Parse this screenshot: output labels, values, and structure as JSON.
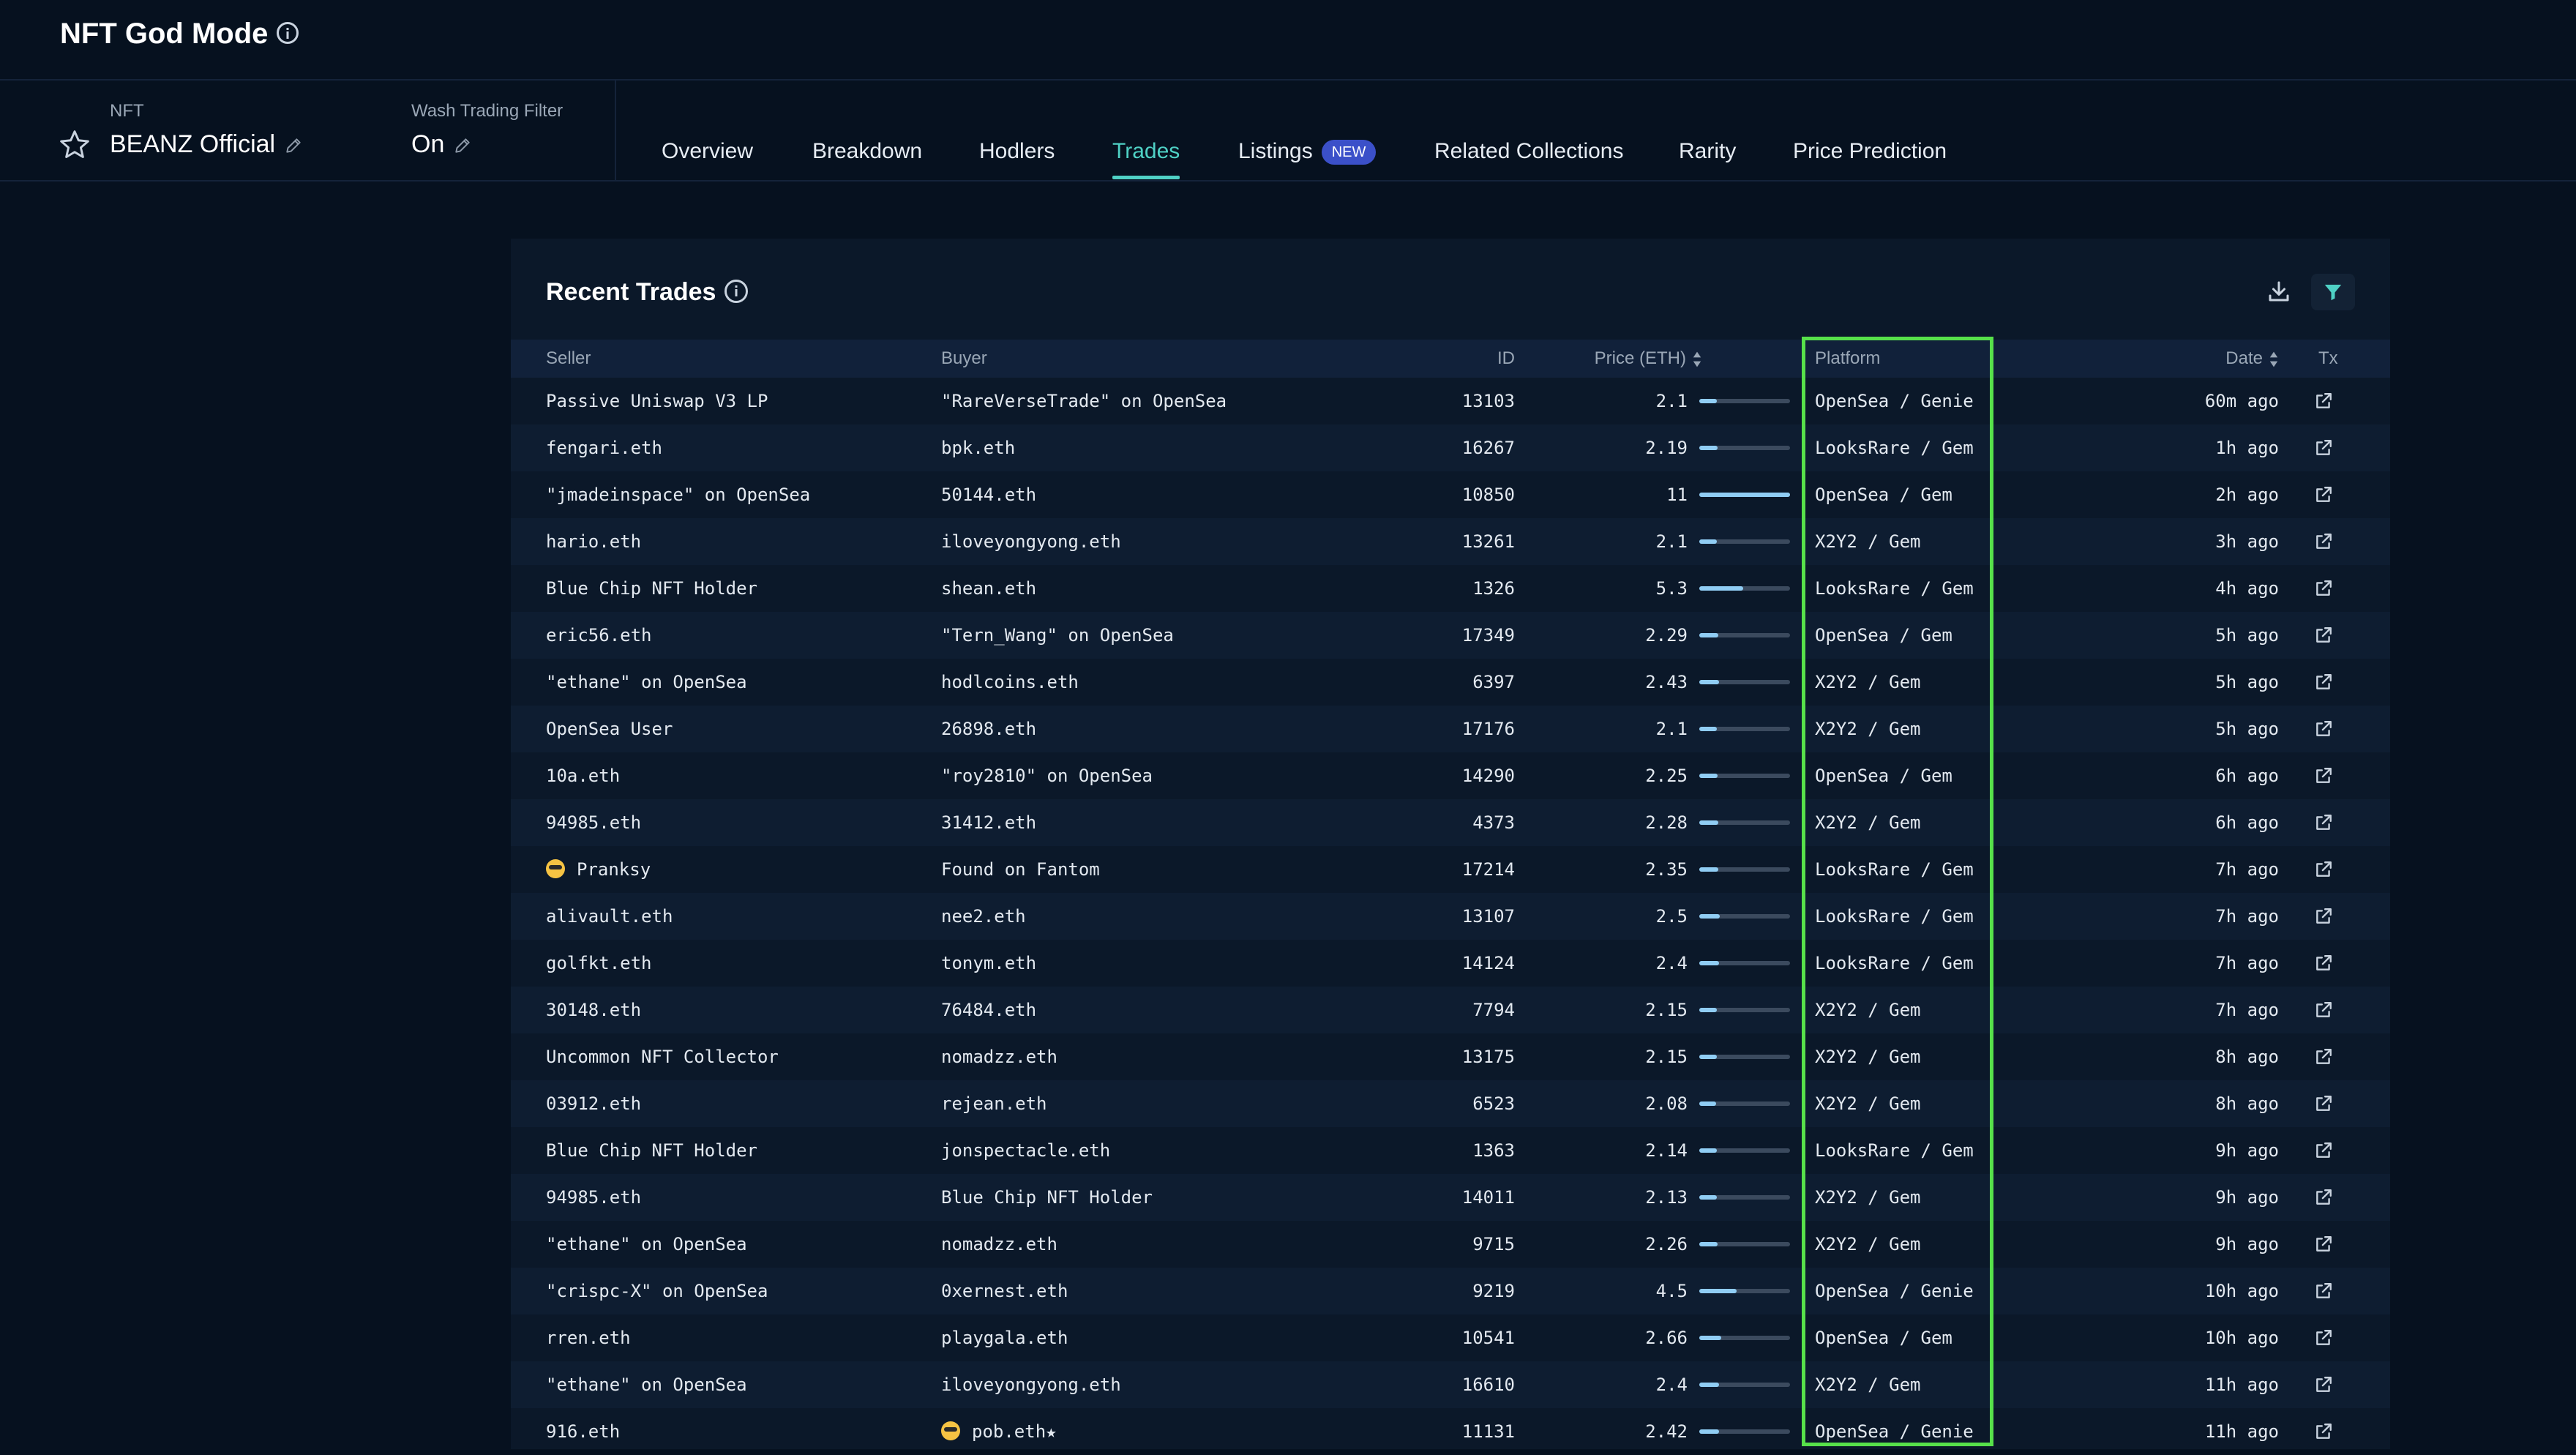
{
  "app": {
    "title": "NFT God Mode"
  },
  "nft": {
    "label": "NFT",
    "name": "BEANZ Official"
  },
  "wash_filter": {
    "label": "Wash Trading Filter",
    "value": "On"
  },
  "tabs": [
    {
      "label": "Overview"
    },
    {
      "label": "Breakdown"
    },
    {
      "label": "Hodlers"
    },
    {
      "label": "Trades",
      "active": true
    },
    {
      "label": "Listings",
      "badge": "NEW"
    },
    {
      "label": "Related Collections"
    },
    {
      "label": "Rarity"
    },
    {
      "label": "Price Prediction"
    }
  ],
  "panel": {
    "title": "Recent Trades"
  },
  "columns": {
    "seller": "Seller",
    "buyer": "Buyer",
    "id": "ID",
    "price": "Price (ETH)",
    "platform": "Platform",
    "date": "Date",
    "tx": "Tx"
  },
  "colors": {
    "accent": "#4fd1c5",
    "highlight": "#57e14a",
    "badge": "#3b50c9",
    "bar": "#90cdf4"
  },
  "price_bar_max": 11,
  "rows": [
    {
      "seller": "Passive Uniswap V3 LP",
      "buyer": "\"RareVerseTrade\" on OpenSea",
      "id": "13103",
      "price": "2.1",
      "platform": "OpenSea / Genie",
      "date": "60m ago"
    },
    {
      "seller": "fengari.eth",
      "buyer": "bpk.eth",
      "id": "16267",
      "price": "2.19",
      "platform": "LooksRare / Gem",
      "date": "1h ago"
    },
    {
      "seller": "\"jmadeinspace\" on OpenSea",
      "buyer": "50144.eth",
      "id": "10850",
      "price": "11",
      "platform": "OpenSea / Gem",
      "date": "2h ago"
    },
    {
      "seller": "hario.eth",
      "buyer": "iloveyongyong.eth",
      "id": "13261",
      "price": "2.1",
      "platform": "X2Y2 / Gem",
      "date": "3h ago"
    },
    {
      "seller": "Blue Chip NFT Holder",
      "buyer": "shean.eth",
      "id": "1326",
      "price": "5.3",
      "platform": "LooksRare / Gem",
      "date": "4h ago"
    },
    {
      "seller": "eric56.eth",
      "buyer": "\"Tern_Wang\" on OpenSea",
      "id": "17349",
      "price": "2.29",
      "platform": "OpenSea / Gem",
      "date": "5h ago"
    },
    {
      "seller": "\"ethane\" on OpenSea",
      "buyer": "hodlcoins.eth",
      "id": "6397",
      "price": "2.43",
      "platform": "X2Y2 / Gem",
      "date": "5h ago"
    },
    {
      "seller": "OpenSea User",
      "buyer": "26898.eth",
      "id": "17176",
      "price": "2.1",
      "platform": "X2Y2 / Gem",
      "date": "5h ago"
    },
    {
      "seller": "10a.eth",
      "buyer": "\"roy2810\" on OpenSea",
      "id": "14290",
      "price": "2.25",
      "platform": "OpenSea / Gem",
      "date": "6h ago"
    },
    {
      "seller": "94985.eth",
      "buyer": "31412.eth",
      "id": "4373",
      "price": "2.28",
      "platform": "X2Y2 / Gem",
      "date": "6h ago"
    },
    {
      "seller": "Pranksy",
      "seller_emoji": true,
      "buyer": "Found on Fantom",
      "id": "17214",
      "price": "2.35",
      "platform": "LooksRare / Gem",
      "date": "7h ago"
    },
    {
      "seller": "alivault.eth",
      "buyer": "nee2.eth",
      "id": "13107",
      "price": "2.5",
      "platform": "LooksRare / Gem",
      "date": "7h ago"
    },
    {
      "seller": "golfkt.eth",
      "buyer": "tonym.eth",
      "id": "14124",
      "price": "2.4",
      "platform": "LooksRare / Gem",
      "date": "7h ago"
    },
    {
      "seller": "30148.eth",
      "buyer": "76484.eth",
      "id": "7794",
      "price": "2.15",
      "platform": "X2Y2 / Gem",
      "date": "7h ago"
    },
    {
      "seller": "Uncommon NFT Collector",
      "buyer": "nomadzz.eth",
      "id": "13175",
      "price": "2.15",
      "platform": "X2Y2 / Gem",
      "date": "8h ago"
    },
    {
      "seller": "03912.eth",
      "buyer": "rejean.eth",
      "id": "6523",
      "price": "2.08",
      "platform": "X2Y2 / Gem",
      "date": "8h ago"
    },
    {
      "seller": "Blue Chip NFT Holder",
      "buyer": "jonspectacle.eth",
      "id": "1363",
      "price": "2.14",
      "platform": "LooksRare / Gem",
      "date": "9h ago"
    },
    {
      "seller": "94985.eth",
      "buyer": "Blue Chip NFT Holder",
      "id": "14011",
      "price": "2.13",
      "platform": "X2Y2 / Gem",
      "date": "9h ago"
    },
    {
      "seller": "\"ethane\" on OpenSea",
      "buyer": "nomadzz.eth",
      "id": "9715",
      "price": "2.26",
      "platform": "X2Y2 / Gem",
      "date": "9h ago"
    },
    {
      "seller": "\"crispc-X\" on OpenSea",
      "buyer": "0xernest.eth",
      "id": "9219",
      "price": "4.5",
      "platform": "OpenSea / Genie",
      "date": "10h ago"
    },
    {
      "seller": "rren.eth",
      "buyer": "playgala.eth",
      "id": "10541",
      "price": "2.66",
      "platform": "OpenSea / Gem",
      "date": "10h ago"
    },
    {
      "seller": "\"ethane\" on OpenSea",
      "buyer": "iloveyongyong.eth",
      "id": "16610",
      "price": "2.4",
      "platform": "X2Y2 / Gem",
      "date": "11h ago"
    },
    {
      "seller": "916.eth",
      "buyer": "pob.eth★",
      "buyer_emoji": true,
      "id": "11131",
      "price": "2.42",
      "platform": "OpenSea / Genie",
      "date": "11h ago"
    }
  ]
}
